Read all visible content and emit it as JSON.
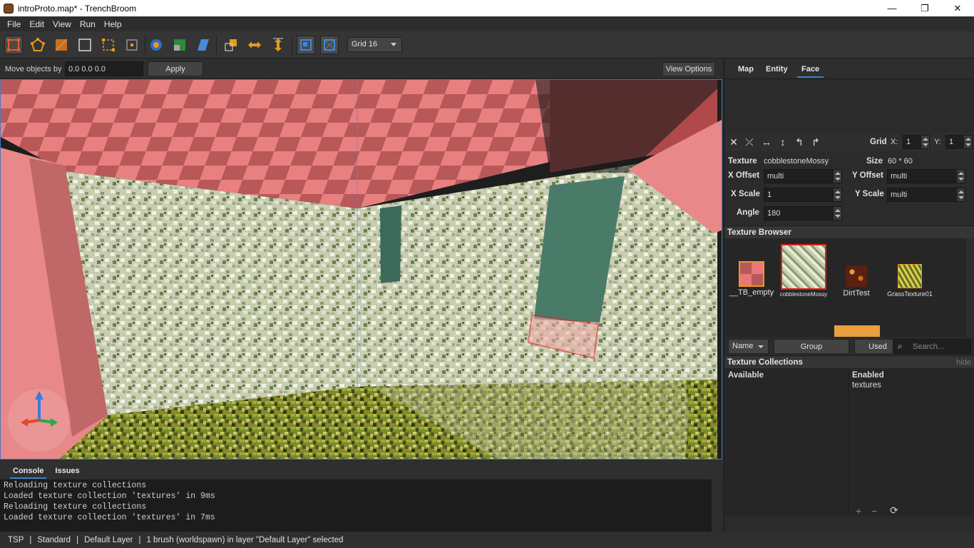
{
  "window": {
    "title": "introProto.map* - TrenchBroom",
    "controls": {
      "minimize": "—",
      "maximize": "❐",
      "close": "✕"
    }
  },
  "menu": {
    "items": [
      "File",
      "Edit",
      "View",
      "Run",
      "Help"
    ]
  },
  "toolbar": {
    "grid_select": "Grid 16",
    "tools": [
      "selection-tool-icon",
      "vertex-tool-icon",
      "edge-tool-icon",
      "face-tool-icon",
      "clip-tool-icon",
      "rotate-origin-icon",
      "texture-lock-icon",
      "uv-lock-icon",
      "shear-icon",
      "duplicate-icon",
      "flip-horizontal-icon",
      "flip-vertical-icon",
      "snap-to-grid-icon",
      "show-grid-icon"
    ]
  },
  "move_bar": {
    "label": "Move objects by",
    "value": "0.0 0.0 0.0",
    "apply_label": "Apply",
    "view_options_label": "View Options"
  },
  "bottom_panel": {
    "tabs": [
      "Console",
      "Issues"
    ],
    "console_lines": [
      "Reloading texture collections",
      "Loaded texture collection 'textures' in 9ms",
      "Reloading texture collections",
      "Loaded texture collection 'textures' in 7ms"
    ]
  },
  "status": {
    "parts": [
      "TSP",
      "|",
      "Standard",
      "|",
      "Default Layer",
      "|",
      "1 brush (worldspawn) in layer \"Default Layer\" selected"
    ]
  },
  "inspector": {
    "tabs": [
      "Map",
      "Entity",
      "Face"
    ],
    "active_tab": "Face",
    "grid_label": "Grid",
    "grid_x_label": "X:",
    "grid_x": "1",
    "grid_y_label": "Y:",
    "grid_y": "1",
    "texture_label": "Texture",
    "texture_value": "cobblestoneMossy",
    "size_label": "Size",
    "size_value": "60 * 60",
    "x_offset_label": "X Offset",
    "x_offset": "multi",
    "y_offset_label": "Y Offset",
    "y_offset": "multi",
    "x_scale_label": "X Scale",
    "x_scale": "1",
    "y_scale_label": "Y Scale",
    "y_scale": "multi",
    "angle_label": "Angle",
    "angle": "180"
  },
  "texture_browser": {
    "header": "Texture Browser",
    "textures": [
      {
        "name": "__TB_empty",
        "color": "#e87878"
      },
      {
        "name": "cobblestoneMossy",
        "color": "#c8d0b0",
        "selected": true
      },
      {
        "name": "DirtTest",
        "color": "#5a2010"
      },
      {
        "name": "GrassTexture01",
        "color": "#b8b030"
      }
    ],
    "sort_select": "Name",
    "group_label": "Group",
    "used_label": "Used",
    "search_placeholder": "Search..."
  },
  "collections": {
    "header": "Texture Collections",
    "hide_label": "hide",
    "available_label": "Available",
    "enabled_label": "Enabled",
    "enabled_items": [
      "textures"
    ],
    "add": "+",
    "remove": "−",
    "reload": "⟳"
  }
}
